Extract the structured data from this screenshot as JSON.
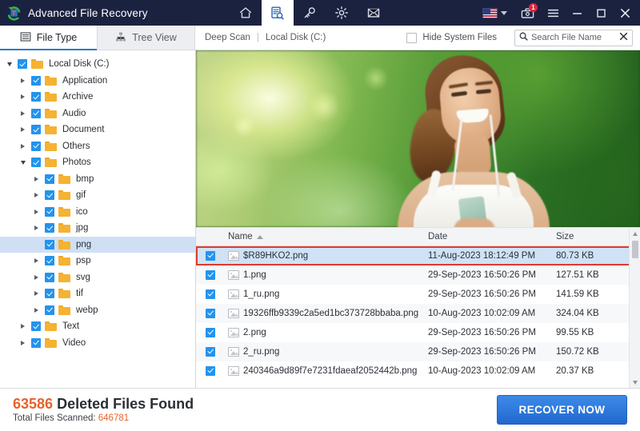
{
  "titlebar": {
    "app_title": "Advanced File Recovery",
    "logo_icon": "recovery-logo-icon",
    "nav": [
      {
        "icon": "home-icon",
        "name": "home",
        "active": false
      },
      {
        "icon": "scan-document-search-icon",
        "name": "scan",
        "active": true
      },
      {
        "icon": "key-icon",
        "name": "key",
        "active": false
      },
      {
        "icon": "gear-icon",
        "name": "settings",
        "active": false
      },
      {
        "icon": "envelope-icon",
        "name": "mail",
        "active": false
      }
    ],
    "language_icon": "us-flag-icon",
    "language_caret": "chevron-down-icon",
    "toolbox_icon": "toolbox-icon",
    "toolbox_badge": "1",
    "menu_icon": "hamburger-menu-icon",
    "minimize_icon": "minimize-icon",
    "maximize_icon": "maximize-icon",
    "close_icon": "close-icon"
  },
  "tabbar": {
    "tabs": [
      {
        "label": "File Type",
        "icon": "list-icon",
        "active": true
      },
      {
        "label": "Tree View",
        "icon": "tree-icon",
        "active": false
      }
    ],
    "scan_mode": "Deep Scan",
    "separator": "|",
    "drive": "Local Disk (C:)",
    "hide_system_files_label": "Hide System Files",
    "hide_system_files_checked": false,
    "search_placeholder": "Search File Name",
    "search_value": "",
    "search_icon": "search-icon",
    "search_clear_icon": "close-icon"
  },
  "sidebar": {
    "nodes": [
      {
        "label": "Local Disk (C:)",
        "depth": 0,
        "arrow": "down",
        "checked": true,
        "selected": false
      },
      {
        "label": "Application",
        "depth": 1,
        "arrow": "right",
        "checked": true,
        "selected": false
      },
      {
        "label": "Archive",
        "depth": 1,
        "arrow": "right",
        "checked": true,
        "selected": false
      },
      {
        "label": "Audio",
        "depth": 1,
        "arrow": "right",
        "checked": true,
        "selected": false
      },
      {
        "label": "Document",
        "depth": 1,
        "arrow": "right",
        "checked": true,
        "selected": false
      },
      {
        "label": "Others",
        "depth": 1,
        "arrow": "right",
        "checked": true,
        "selected": false
      },
      {
        "label": "Photos",
        "depth": 1,
        "arrow": "down",
        "checked": true,
        "selected": false
      },
      {
        "label": "bmp",
        "depth": 2,
        "arrow": "right",
        "checked": true,
        "selected": false
      },
      {
        "label": "gif",
        "depth": 2,
        "arrow": "right",
        "checked": true,
        "selected": false
      },
      {
        "label": "ico",
        "depth": 2,
        "arrow": "right",
        "checked": true,
        "selected": false
      },
      {
        "label": "jpg",
        "depth": 2,
        "arrow": "right",
        "checked": true,
        "selected": false
      },
      {
        "label": "png",
        "depth": 2,
        "arrow": "none",
        "checked": true,
        "selected": true
      },
      {
        "label": "psp",
        "depth": 2,
        "arrow": "right",
        "checked": true,
        "selected": false
      },
      {
        "label": "svg",
        "depth": 2,
        "arrow": "right",
        "checked": true,
        "selected": false
      },
      {
        "label": "tif",
        "depth": 2,
        "arrow": "right",
        "checked": true,
        "selected": false
      },
      {
        "label": "webp",
        "depth": 2,
        "arrow": "right",
        "checked": true,
        "selected": false
      },
      {
        "label": "Text",
        "depth": 1,
        "arrow": "right",
        "checked": true,
        "selected": false
      },
      {
        "label": "Video",
        "depth": 1,
        "arrow": "right",
        "checked": true,
        "selected": false
      }
    ]
  },
  "preview": {
    "alt": "woman-jogging-photo-preview"
  },
  "filelist": {
    "columns": {
      "name": "Name",
      "date": "Date",
      "size": "Size"
    },
    "sort_column": "Name",
    "sort_direction": "asc",
    "rows": [
      {
        "name": "$R89HKO2.png",
        "date": "11-Aug-2023 18:12:49 PM",
        "size": "80.73 KB",
        "checked": true,
        "selected": true,
        "highlighted": true
      },
      {
        "name": "1.png",
        "date": "29-Sep-2023 16:50:26 PM",
        "size": "127.51 KB",
        "checked": true,
        "selected": false,
        "highlighted": false
      },
      {
        "name": "1_ru.png",
        "date": "29-Sep-2023 16:50:26 PM",
        "size": "141.59 KB",
        "checked": true,
        "selected": false,
        "highlighted": false
      },
      {
        "name": "19326ffb9339c2a5ed1bc373728bbaba.png",
        "date": "10-Aug-2023 10:02:09 AM",
        "size": "324.04 KB",
        "checked": true,
        "selected": false,
        "highlighted": false
      },
      {
        "name": "2.png",
        "date": "29-Sep-2023 16:50:26 PM",
        "size": "99.55 KB",
        "checked": true,
        "selected": false,
        "highlighted": false
      },
      {
        "name": "2_ru.png",
        "date": "29-Sep-2023 16:50:26 PM",
        "size": "150.72 KB",
        "checked": true,
        "selected": false,
        "highlighted": false
      },
      {
        "name": "240346a9d89f7e7231fdaeaf2052442b.png",
        "date": "10-Aug-2023 10:02:09 AM",
        "size": "20.37 KB",
        "checked": true,
        "selected": false,
        "highlighted": false
      }
    ],
    "scrollbar": {
      "up_icon": "chevron-up-icon",
      "down_icon": "chevron-down-icon"
    }
  },
  "footer": {
    "deleted_count": "63586",
    "deleted_label": "Deleted Files Found",
    "scanned_label": "Total Files Scanned:",
    "scanned_count": "646781",
    "recover_button": "RECOVER NOW"
  },
  "colors": {
    "titlebar_bg": "#1b2240",
    "accent_blue": "#2979d8",
    "recover_blue": "#2f7fe0",
    "orange": "#e8622a",
    "selection_blue": "#cfe2f6",
    "highlight_red": "#e03a2f",
    "folder_yellow": "#f5b233",
    "checkbox_blue": "#2393ee"
  }
}
